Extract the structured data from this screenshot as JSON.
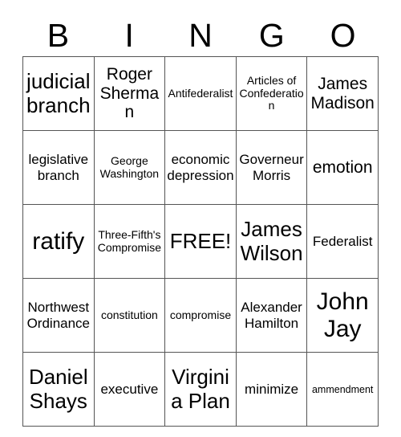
{
  "card": {
    "header": {
      "letters": [
        "B",
        "I",
        "N",
        "G",
        "O"
      ]
    },
    "grid": {
      "rows": [
        [
          {
            "text": "judicial branch",
            "size": "fs-lg"
          },
          {
            "text": "Roger Sherman",
            "size": "fs-md"
          },
          {
            "text": "Antifederalist",
            "size": "fs-xs"
          },
          {
            "text": "Articles of Confederation",
            "size": "fs-xs"
          },
          {
            "text": "James Madison",
            "size": "fs-md"
          }
        ],
        [
          {
            "text": "legislative branch",
            "size": "fs-sm"
          },
          {
            "text": "George Washington",
            "size": "fs-xs"
          },
          {
            "text": "economic depression",
            "size": "fs-sm"
          },
          {
            "text": "Governeur Morris",
            "size": "fs-sm"
          },
          {
            "text": "emotion",
            "size": "fs-md"
          }
        ],
        [
          {
            "text": "ratify",
            "size": "fs-xl"
          },
          {
            "text": "Three-Fifth's Compromise",
            "size": "fs-xs"
          },
          {
            "text": "FREE!",
            "size": "fs-lg"
          },
          {
            "text": "James Wilson",
            "size": "fs-lg"
          },
          {
            "text": "Federalist",
            "size": "fs-sm"
          }
        ],
        [
          {
            "text": "Northwest Ordinance",
            "size": "fs-sm"
          },
          {
            "text": "constitution",
            "size": "fs-xs"
          },
          {
            "text": "compromise",
            "size": "fs-xs"
          },
          {
            "text": "Alexander Hamilton",
            "size": "fs-sm"
          },
          {
            "text": "John Jay",
            "size": "fs-xl"
          }
        ],
        [
          {
            "text": "Daniel Shays",
            "size": "fs-lg"
          },
          {
            "text": "executive",
            "size": "fs-sm"
          },
          {
            "text": "Virginia Plan",
            "size": "fs-lg"
          },
          {
            "text": "minimize",
            "size": "fs-sm"
          },
          {
            "text": "ammendment",
            "size": "fs-xxs"
          }
        ]
      ]
    }
  }
}
